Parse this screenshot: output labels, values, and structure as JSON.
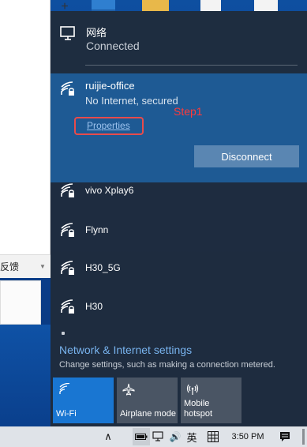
{
  "desktop": {
    "window_plus": "+",
    "feedback_label": "反馈",
    "strip_caret": "▼"
  },
  "flyout": {
    "connection": {
      "title": "网络",
      "status": "Connected"
    },
    "active_network": {
      "name": "ruijie-office",
      "status": "No Internet, secured",
      "properties_label": "Properties",
      "disconnect_label": "Disconnect",
      "annotation": "Step1"
    },
    "networks": [
      {
        "name": "vivo Xplay6"
      },
      {
        "name": "Flynn"
      },
      {
        "name": "H30_5G"
      },
      {
        "name": "H30"
      }
    ],
    "settings": {
      "title": "Network & Internet settings",
      "subtitle": "Change settings, such as making a connection metered."
    },
    "quick_actions": [
      {
        "label": "Wi-Fi",
        "icon": "wifi-icon",
        "active": true
      },
      {
        "label": "Airplane mode",
        "icon": "airplane-icon",
        "active": false
      },
      {
        "label": "Mobile\nhotspot",
        "icon": "hotspot-icon",
        "active": false
      }
    ]
  },
  "taskbar": {
    "chevron": "∧",
    "volume": "🔊",
    "ime": "英",
    "time": "3:50 PM"
  },
  "colors": {
    "accent": "#1976d2",
    "active_bg": "#1e5a94",
    "flyout_bg": "#1f2c3c",
    "link": "#78b3ee",
    "annotation": "#ff3a3a"
  }
}
